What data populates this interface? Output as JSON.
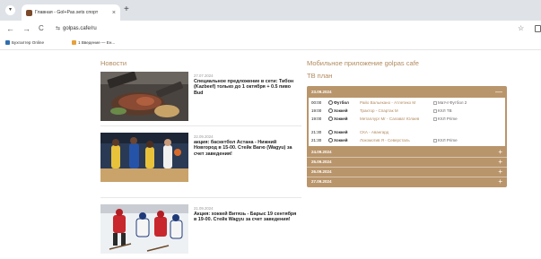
{
  "browser": {
    "tab_title": "Главная - Gol+Pas.sets спорт",
    "tab_close": "×",
    "new_tab": "+",
    "url": "golpas.cafe/ru",
    "back": "←",
    "forward": "→",
    "reload": "C",
    "bookmark_star": "☆",
    "site_info": "⇆",
    "bookmarks": [
      {
        "label": "Бухгалтер Online",
        "icon_color": "#2f6fb0"
      },
      {
        "label": "1 Введение — Ен...",
        "icon_color": "#e6a23c"
      }
    ]
  },
  "news": {
    "title": "Новости",
    "items": [
      {
        "date": "27.07.2024",
        "text": "Специальное предложение в сети: Тибон (Kazbeef) только до 1 октября + 0.5 пиво Bud"
      },
      {
        "date": "22.09.2024",
        "text": "акция: баскетбол Астана - Нижний Новгород в 15-00. Стейк Вагю (Wagyu) за счет заведения!"
      },
      {
        "date": "21.09.2024",
        "text": "Акция: хоккей Витязь - Барыс 19 сентября в 19-00. Стейк Wagyu за счет заведения!"
      }
    ]
  },
  "mobile_app": {
    "title": "Мобильное приложение golpas cafe"
  },
  "tv": {
    "title": "ТВ план",
    "days": [
      {
        "label": "23.09.2024",
        "toggle": "—",
        "expanded": true
      },
      {
        "label": "24.09.2024",
        "toggle": "+"
      },
      {
        "label": "25.09.2024",
        "toggle": "+"
      },
      {
        "label": "26.09.2024",
        "toggle": "+"
      },
      {
        "label": "27.09.2024",
        "toggle": "+"
      }
    ],
    "rows": [
      {
        "time": "00:00",
        "sport": "Футбол",
        "match": "Райо Вальекано - Атлетико М",
        "channel": "Матч! Футбол 2"
      },
      {
        "time": "19:00",
        "sport": "Хоккей",
        "match": "Трактор - Спартак М",
        "channel": "КХЛ ТВ"
      },
      {
        "time": "19:00",
        "sport": "Хоккей",
        "match": "Металлург Мг - Салават Юлаев",
        "channel": "КХЛ Prime"
      },
      {
        "time": "21:30",
        "sport": "Хоккей",
        "match": "СКА - Авангард",
        "channel": ""
      },
      {
        "time": "21:30",
        "sport": "Хоккей",
        "match": "Локомотив Я - Северсталь",
        "channel": "КХЛ Prime"
      }
    ]
  },
  "colors": {
    "accent": "#b08a5e",
    "panel": "#b9956b"
  }
}
